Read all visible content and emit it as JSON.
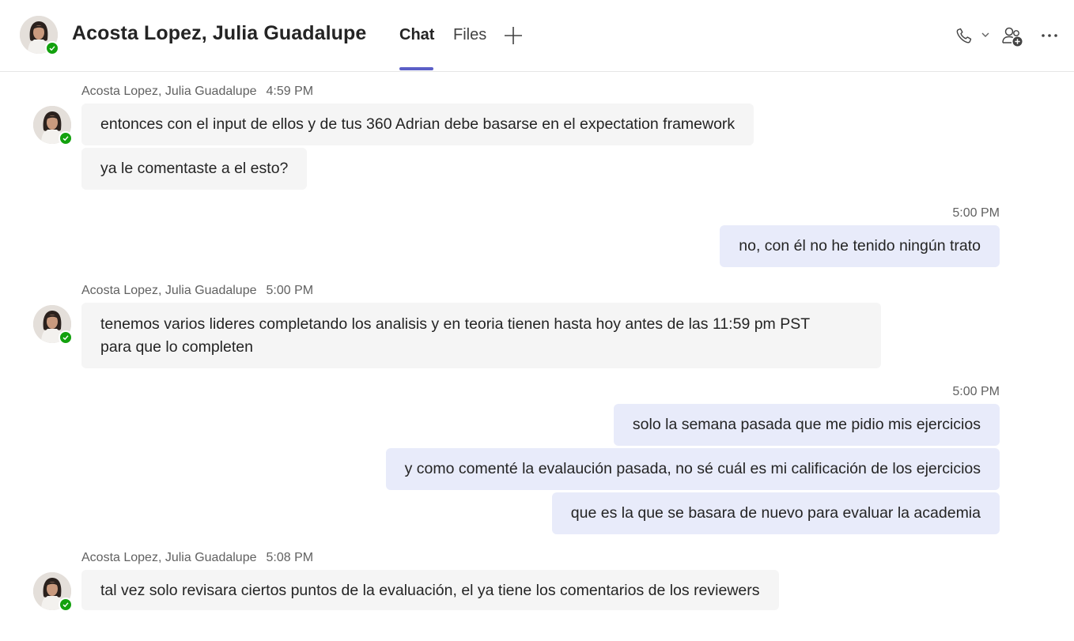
{
  "header": {
    "contact_name": "Acosta Lopez, Julia Guadalupe",
    "tabs": [
      {
        "label": "Chat",
        "selected": true
      },
      {
        "label": "Files",
        "selected": false
      }
    ],
    "presence": "available"
  },
  "colors": {
    "accent": "#5b5fc7",
    "presence_available": "#13a10e",
    "incoming_bubble": "#f5f5f5",
    "outgoing_bubble": "#e8ebfa"
  },
  "icons": {
    "add_tab": "plus-icon",
    "call": "phone-icon",
    "call_dropdown": "chevron-down-icon",
    "add_people": "add-people-icon",
    "more": "more-options-icon"
  },
  "messages": [
    {
      "direction": "incoming",
      "sender": "Acosta Lopez, Julia Guadalupe",
      "time": "4:59 PM",
      "lines": [
        "entonces con el input de ellos y de tus 360 Adrian debe basarse en el expectation framework",
        "ya le comentaste a el esto?"
      ]
    },
    {
      "direction": "outgoing",
      "time": "5:00 PM",
      "lines": [
        "no, con él no he tenido ningún trato"
      ]
    },
    {
      "direction": "incoming",
      "sender": "Acosta Lopez, Julia Guadalupe",
      "time": "5:00 PM",
      "lines": [
        "tenemos varios lideres completando los analisis y en teoria tienen hasta hoy antes de las 11:59 pm PST\npara que lo completen"
      ]
    },
    {
      "direction": "outgoing",
      "time": "5:00 PM",
      "lines": [
        "solo la semana pasada que me pidio mis ejercicios",
        "y como comenté la evalaución pasada, no sé cuál es mi calificación de los ejercicios",
        "que es la que se basara de nuevo para evaluar la academia"
      ]
    },
    {
      "direction": "incoming",
      "sender": "Acosta Lopez, Julia Guadalupe",
      "time": "5:08 PM",
      "lines": [
        "tal vez solo revisara ciertos puntos de la evaluación, el ya tiene los comentarios de los reviewers"
      ]
    }
  ]
}
